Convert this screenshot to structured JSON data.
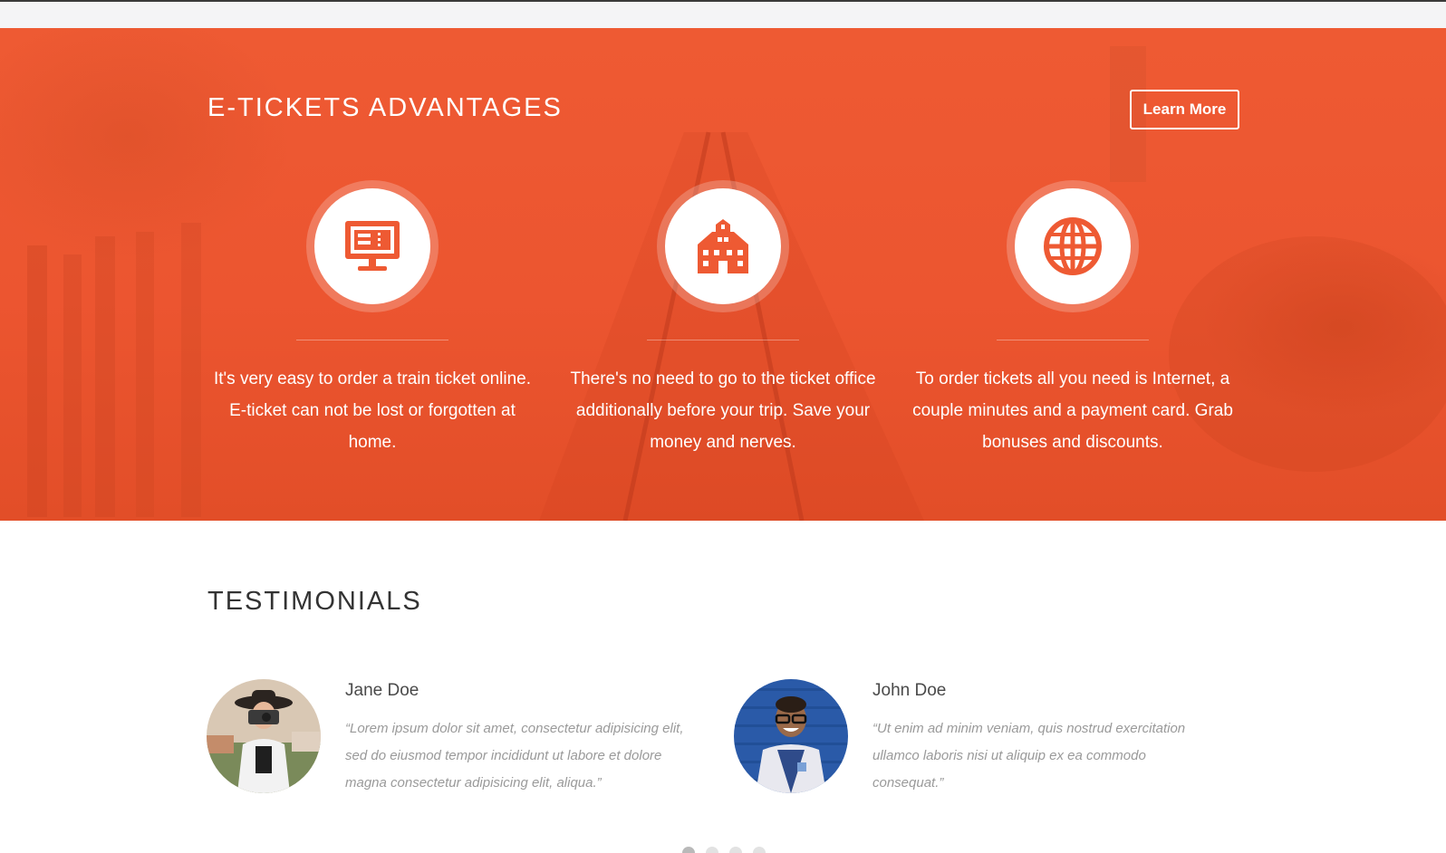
{
  "colors": {
    "accent": "#ee5a33",
    "white": "#ffffff",
    "heading": "#333333",
    "muted": "#9a9a9a"
  },
  "hero": {
    "title": "E-TICKETS ADVANTAGES",
    "learn_more_label": "Learn More",
    "features": [
      {
        "icon": "monitor-ticket-icon",
        "text": "It's very easy to order a train ticket online. E-ticket can not be lost or forgotten at home."
      },
      {
        "icon": "building-icon",
        "text": "There's no need to go to the ticket office additionally before your trip. Save your money and nerves."
      },
      {
        "icon": "globe-icon",
        "text": "To order tickets all you need is Internet, a couple minutes and a payment card. Grab bonuses and discounts."
      }
    ]
  },
  "testimonials": {
    "title": "TESTIMONIALS",
    "items": [
      {
        "name": "Jane Doe",
        "quote": "“Lorem ipsum dolor sit amet, consectetur adipisicing elit, sed do eiusmod tempor incididunt ut labore et dolore magna  consectetur adipisicing elit, aliqua.”"
      },
      {
        "name": "John Doe",
        "quote": "“Ut enim ad minim veniam, quis nostrud exercitation ullamco laboris nisi ut aliquip ex ea commodo consequat.”"
      }
    ],
    "pagination": {
      "count": 4,
      "active": 1
    }
  }
}
